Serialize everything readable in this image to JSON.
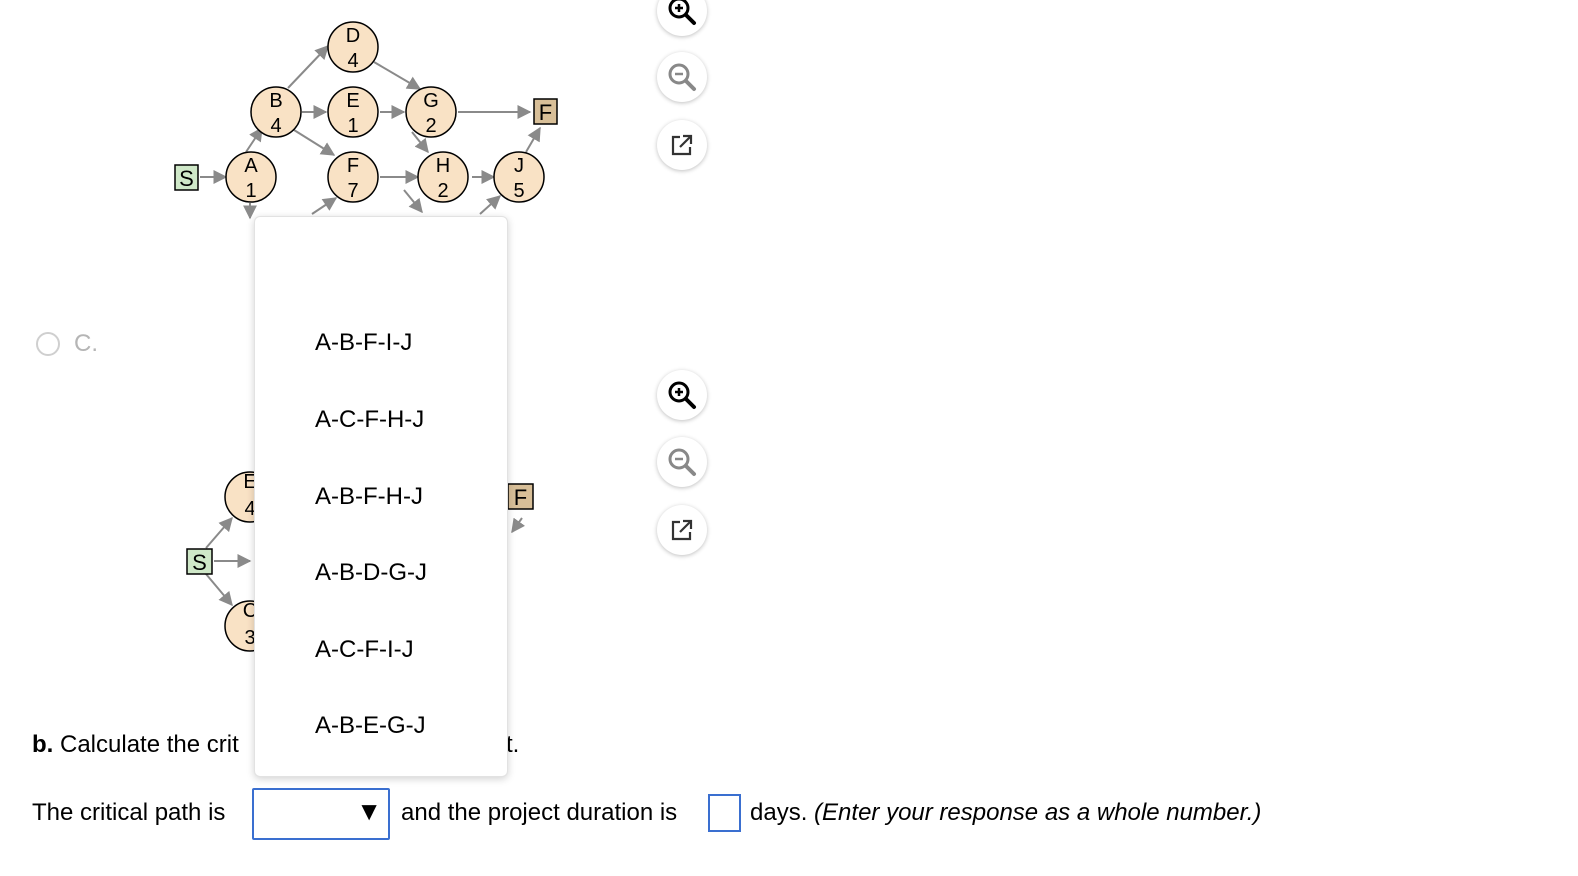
{
  "network_a": {
    "start": "S",
    "finish": "F",
    "nodes": [
      {
        "id": "A",
        "dur": "1"
      },
      {
        "id": "B",
        "dur": "4"
      },
      {
        "id": "D",
        "dur": "4"
      },
      {
        "id": "E",
        "dur": "1"
      },
      {
        "id": "G",
        "dur": "2"
      },
      {
        "id": "F",
        "dur": "7"
      },
      {
        "id": "H",
        "dur": "2"
      },
      {
        "id": "J",
        "dur": "5"
      }
    ]
  },
  "network_c": {
    "start": "S",
    "finish": "F",
    "partial_labels": [
      "E",
      "4",
      "C",
      "3"
    ]
  },
  "option_c": {
    "label": "C."
  },
  "dropdown": {
    "options": [
      "A-B-F-I-J",
      "A-C-F-H-J",
      "A-B-F-H-J",
      "A-B-D-G-J",
      "A-C-F-I-J",
      "A-B-E-G-J"
    ]
  },
  "question_b": {
    "bold": "b.",
    "text": "Calculate the crit",
    "tail": "t."
  },
  "answer_line": {
    "prefix": "The critical path is",
    "middle": "and the project duration is",
    "days": "days.",
    "hint": "(Enter your response as a whole number.)",
    "arrow": "▼"
  },
  "colors": {
    "node_fill": "#f9e2c5",
    "start_fill": "#cfe8c8",
    "finish_fill": "#d8bf98",
    "select_border": "#3a6fd0"
  }
}
